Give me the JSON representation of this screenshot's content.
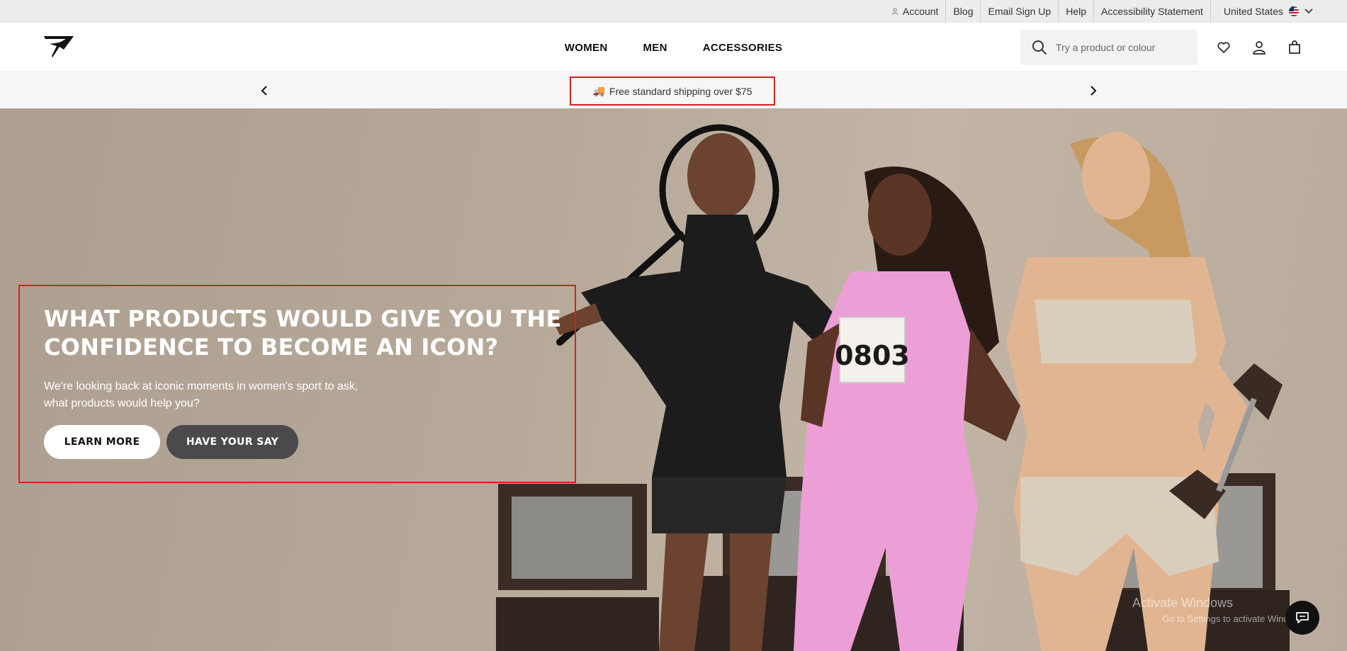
{
  "utility_bar": {
    "account": "Account",
    "blog": "Blog",
    "email_signup": "Email Sign Up",
    "help": "Help",
    "accessibility": "Accessibility Statement",
    "country": "United States"
  },
  "header": {
    "nav": [
      "WOMEN",
      "MEN",
      "ACCESSORIES"
    ],
    "search_placeholder": "Try a product or colour"
  },
  "promo": {
    "message": "Free standard shipping over $75"
  },
  "hero": {
    "title": "WHAT PRODUCTS WOULD GIVE YOU THE CONFIDENCE TO BECOME AN ICON?",
    "subtitle": "We're looking back at iconic moments in women's sport to ask, what products would help you?",
    "learn_more": "LEARN MORE",
    "have_your_say": "HAVE YOUR SAY",
    "bib_number": "0803"
  },
  "watermark": {
    "line1": "Activate Windows",
    "line2": "Go to Settings to activate Windows."
  },
  "colors": {
    "highlight": "#d61f1f",
    "hero_bg": "#b7a999",
    "dark_button": "#4a4a4d"
  }
}
